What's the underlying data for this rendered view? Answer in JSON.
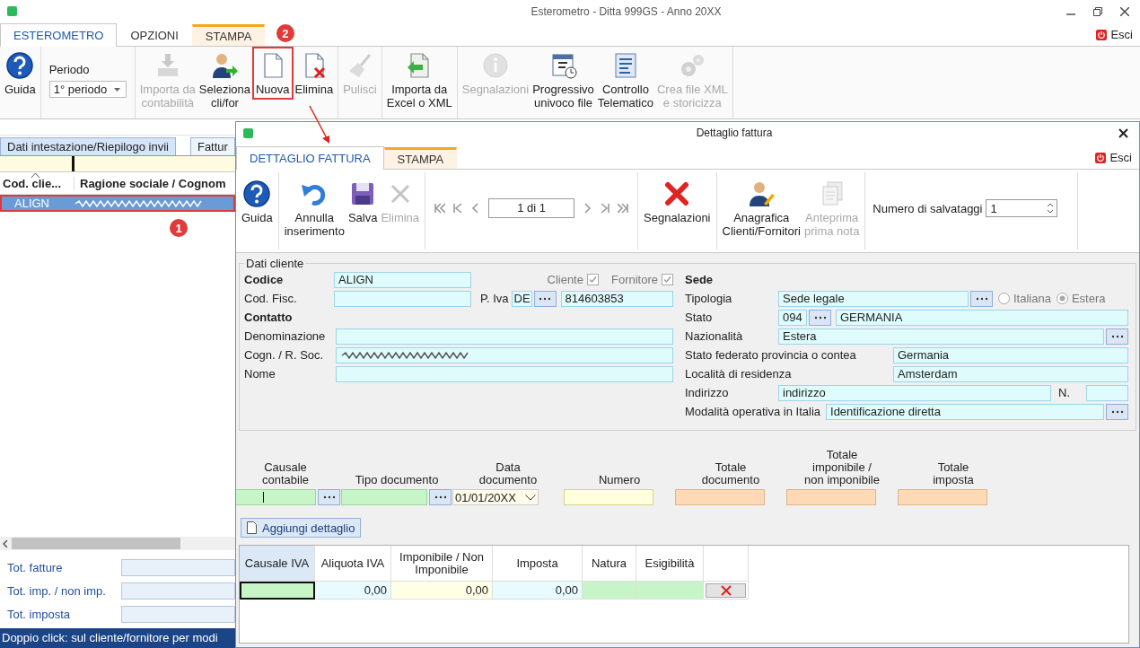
{
  "window": {
    "title": "Esterometro - Ditta 999GS - Anno 20XX"
  },
  "ribbon_tabs": [
    {
      "label": "ESTEROMETRO",
      "selected": true,
      "contextual": false
    },
    {
      "label": "OPZIONI",
      "selected": false,
      "contextual": false
    },
    {
      "label": "STAMPA",
      "selected": false,
      "contextual": true
    }
  ],
  "exit_button": "Esci",
  "ribbon_groups": [
    [
      {
        "kind": "help",
        "label": "Guida",
        "disabled": false,
        "highlighted": false
      }
    ],
    [
      {
        "kind": "select",
        "label": "Periodo",
        "value": "1° periodo"
      }
    ],
    [
      {
        "kind": "import-db",
        "label": "Importa da\ncontabilità",
        "disabled": true,
        "highlighted": false
      },
      {
        "kind": "select-user",
        "label": "Seleziona\ncli/for",
        "disabled": false,
        "highlighted": false
      },
      {
        "kind": "new-doc",
        "label": "Nuova",
        "disabled": false,
        "highlighted": true,
        "callout": "2"
      },
      {
        "kind": "delete-doc",
        "label": "Elimina",
        "disabled": false,
        "highlighted": false
      }
    ],
    [
      {
        "kind": "broom",
        "label": "Pulisci",
        "disabled": true,
        "highlighted": false
      }
    ],
    [
      {
        "kind": "import-excel",
        "label": "Importa da\nExcel o XML",
        "disabled": false,
        "highlighted": false
      }
    ],
    [
      {
        "kind": "info",
        "label": "Segnalazioni",
        "disabled": true,
        "highlighted": false
      },
      {
        "kind": "calendar",
        "label": "Progressivo\nunivoco file",
        "disabled": false,
        "highlighted": false
      },
      {
        "kind": "report",
        "label": "Controllo\nTelematico",
        "disabled": false,
        "highlighted": false
      },
      {
        "kind": "gears",
        "label": "Crea file XML\ne storicizza",
        "disabled": true,
        "highlighted": false
      }
    ]
  ],
  "list_panel": {
    "tabs": [
      {
        "label": "Dati intestazione/Riepilogo invii",
        "selected": false
      },
      {
        "label": "Fattur",
        "selected": true
      }
    ],
    "columns": [
      "Cod. clie...",
      "Ragione sociale / Cognom"
    ],
    "rows": [
      {
        "code": "ALIGN",
        "redacted": true,
        "selected": true,
        "highlighted": true,
        "callout": "1"
      }
    ],
    "totals": [
      "Tot. fatture",
      "Tot. imp. / non imp.",
      "Tot. imposta"
    ],
    "status": "Doppio click: sul cliente/fornitore per modi"
  },
  "dialog": {
    "title": "Dettaglio fattura",
    "tabs": [
      {
        "label": "DETTAGLIO FATTURA",
        "selected": true,
        "contextual": false
      },
      {
        "label": "STAMPA",
        "selected": false,
        "contextual": true
      }
    ],
    "exit_button": "Esci",
    "toolbar": [
      [
        {
          "kind": "help",
          "label": "Guida",
          "disabled": false
        }
      ],
      [
        {
          "kind": "undo",
          "label": "Annulla\ninserimento",
          "disabled": false
        },
        {
          "kind": "save",
          "label": "Salva",
          "disabled": false
        },
        {
          "kind": "delete",
          "label": "Elimina",
          "disabled": true
        }
      ],
      [
        {
          "kind": "pager",
          "value": "1 di 1"
        }
      ],
      [
        {
          "kind": "alerts",
          "label": "Segnalazioni",
          "disabled": false
        }
      ],
      [
        {
          "kind": "contacts",
          "label": "Anagrafica\nClienti/Fornitori",
          "disabled": false
        },
        {
          "kind": "preview",
          "label": "Anteprima\nprima nota",
          "disabled": true
        }
      ],
      [
        {
          "kind": "counter",
          "label": "Numero di salvataggi",
          "value": "1"
        }
      ]
    ],
    "customer": {
      "title": "Dati cliente",
      "code": {
        "label": "Codice",
        "value": "ALIGN"
      },
      "roles": [
        {
          "label": "Cliente",
          "checked": true
        },
        {
          "label": "Fornitore",
          "checked": true
        }
      ],
      "tax_code": {
        "label": "Cod. Fisc."
      },
      "vat": {
        "label": "P. Iva",
        "country": "DE",
        "number": "814603853"
      },
      "contact_title": "Contatto",
      "contact_fields": [
        {
          "label": "Denominazione",
          "redacted": false
        },
        {
          "label": "Cogn. / R. Soc.",
          "redacted": true
        },
        {
          "label": "Nome",
          "redacted": false
        }
      ],
      "seat_title": "Sede",
      "type": {
        "label": "Tipologia",
        "value": "Sede legale"
      },
      "location": [
        {
          "label": "Italiana",
          "selected": false
        },
        {
          "label": "Estera",
          "selected": true
        }
      ],
      "country": {
        "label": "Stato",
        "code": "094",
        "name": "GERMANIA"
      },
      "nationality": {
        "label": "Nazionalità",
        "value": "Estera"
      },
      "state": {
        "label": "Stato federato provincia o contea",
        "value": "Germania"
      },
      "city": {
        "label": "Località di residenza",
        "value": "Amsterdam"
      },
      "address": {
        "label": "Indirizzo",
        "value": "indirizzo",
        "number_label": "N."
      },
      "operating_mode": {
        "label": "Modalità operativa in Italia",
        "value": "Identificazione diretta"
      }
    }
  },
  "document": {
    "fields": [
      {
        "kind": "lookup",
        "label": "Causale\ncontabile"
      },
      {
        "kind": "lookup",
        "label": "Tipo documento"
      },
      {
        "kind": "date",
        "label": "Data\ndocumento",
        "value": "01/01/20XX"
      },
      {
        "kind": "text",
        "label": "Numero"
      },
      {
        "kind": "total",
        "label": "Totale\ndocumento"
      },
      {
        "kind": "total",
        "label": "Totale\nimponibile /\nnon imponibile"
      },
      {
        "kind": "total",
        "label": "Totale\nimposta"
      }
    ],
    "add_button": "Aggiungi dettaglio",
    "grid": {
      "columns": [
        "Causale IVA",
        "Aliquota IVA",
        "Imponibile / Non\nImponibile",
        "Imposta",
        "Natura",
        "Esigibilità"
      ],
      "row": [
        {
          "kind": "lookup",
          "selected": true
        },
        {
          "kind": "rate",
          "value": "0,00",
          "selected": false
        },
        {
          "kind": "amount",
          "value": "0,00",
          "selected": false
        },
        {
          "kind": "rate",
          "value": "0,00",
          "selected": false
        },
        {
          "kind": "lookup",
          "selected": false
        },
        {
          "kind": "lookup",
          "selected": false
        },
        {
          "kind": "delete",
          "selected": false
        }
      ]
    }
  }
}
